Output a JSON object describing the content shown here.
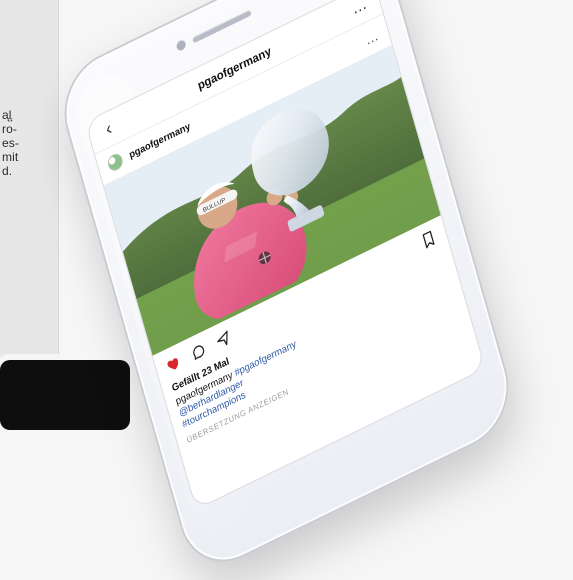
{
  "left_panel": {
    "text": "al\nro-\nes-\nmit\nd.",
    "quote": "“"
  },
  "instagram": {
    "topbar": {
      "title": "pgaofgermany"
    },
    "post": {
      "username": "pgaofgermany",
      "likes": "Gefällt 23 Mal",
      "caption_line1_user": "pgaofgermany",
      "caption_line1_hashtag": "#pgaofgermany",
      "caption_line2_handle": "@berhardlanger",
      "caption_line3_hashtag": "#tourchampions",
      "translate": "ÜBERSETZUNG ANZEIGEN"
    }
  },
  "colors": {
    "heart": "#d9262d",
    "hashtag": "#2f5aa8"
  }
}
